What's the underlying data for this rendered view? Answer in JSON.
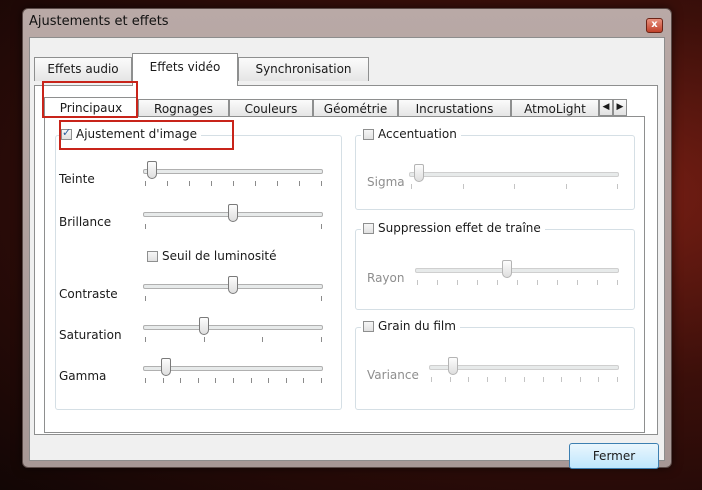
{
  "window": {
    "title": "Ajustements et effets",
    "close_label": "x"
  },
  "top_tabs": [
    "Effets audio",
    "Effets vidéo",
    "Synchronisation"
  ],
  "sub_tabs": [
    "Principaux",
    "Rognages",
    "Couleurs",
    "Géométrie",
    "Incrustations",
    "AtmoLight"
  ],
  "scroll": {
    "left": "◀",
    "right": "▶"
  },
  "image_adjust": {
    "title": "Ajustement d'image",
    "checked": true,
    "sliders": {
      "teinte": {
        "label": "Teinte",
        "value": 0.02
      },
      "brillance": {
        "label": "Brillance",
        "value": 0.5
      },
      "contraste": {
        "label": "Contraste",
        "value": 0.5
      },
      "saturation": {
        "label": "Saturation",
        "value": 0.33
      },
      "gamma": {
        "label": "Gamma",
        "value": 0.1
      }
    },
    "threshold_label": "Seuil de luminosité"
  },
  "sharpen": {
    "title": "Accentuation",
    "slider_label": "Sigma",
    "value": 0.02
  },
  "trail": {
    "title": "Suppression effet de traîne",
    "slider_label": "Rayon",
    "value": 0.45
  },
  "grain": {
    "title": "Grain du film",
    "slider_label": "Variance",
    "value": 0.1
  },
  "buttons": {
    "close": "Fermer"
  }
}
